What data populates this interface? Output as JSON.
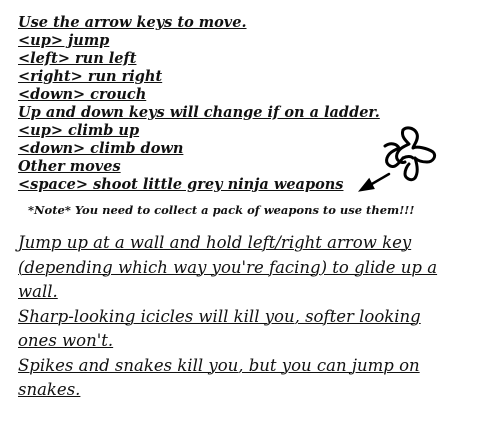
{
  "controls": {
    "intro": "Use the arrow keys to move.",
    "up_jump": "<up> jump",
    "left_run": "<left> run left",
    "right_run": "<right> run right",
    "down_crouch": "<down> crouch",
    "ladder_intro": "Up and down keys will change if on a ladder.",
    "up_climb": "<up> climb up",
    "down_climb": "<down> climb down",
    "other_heading": "Other moves",
    "space_shoot": "<space> shoot little grey ninja weapons"
  },
  "note": "*Note* You need to collect a pack of weapons to use them!!!",
  "tips": [
    "Jump up at a wall and hold left/right arrow key (depending which way you're facing) to glide up a wall.",
    "Sharp-looking icicles will kill you, softer looking ones won't.",
    "Spikes and snakes kill you, but you can jump on snakes."
  ],
  "illustration": {
    "icon": "ninja-star-icon",
    "arrow_icon": "arrow-icon",
    "color": "#000000"
  }
}
